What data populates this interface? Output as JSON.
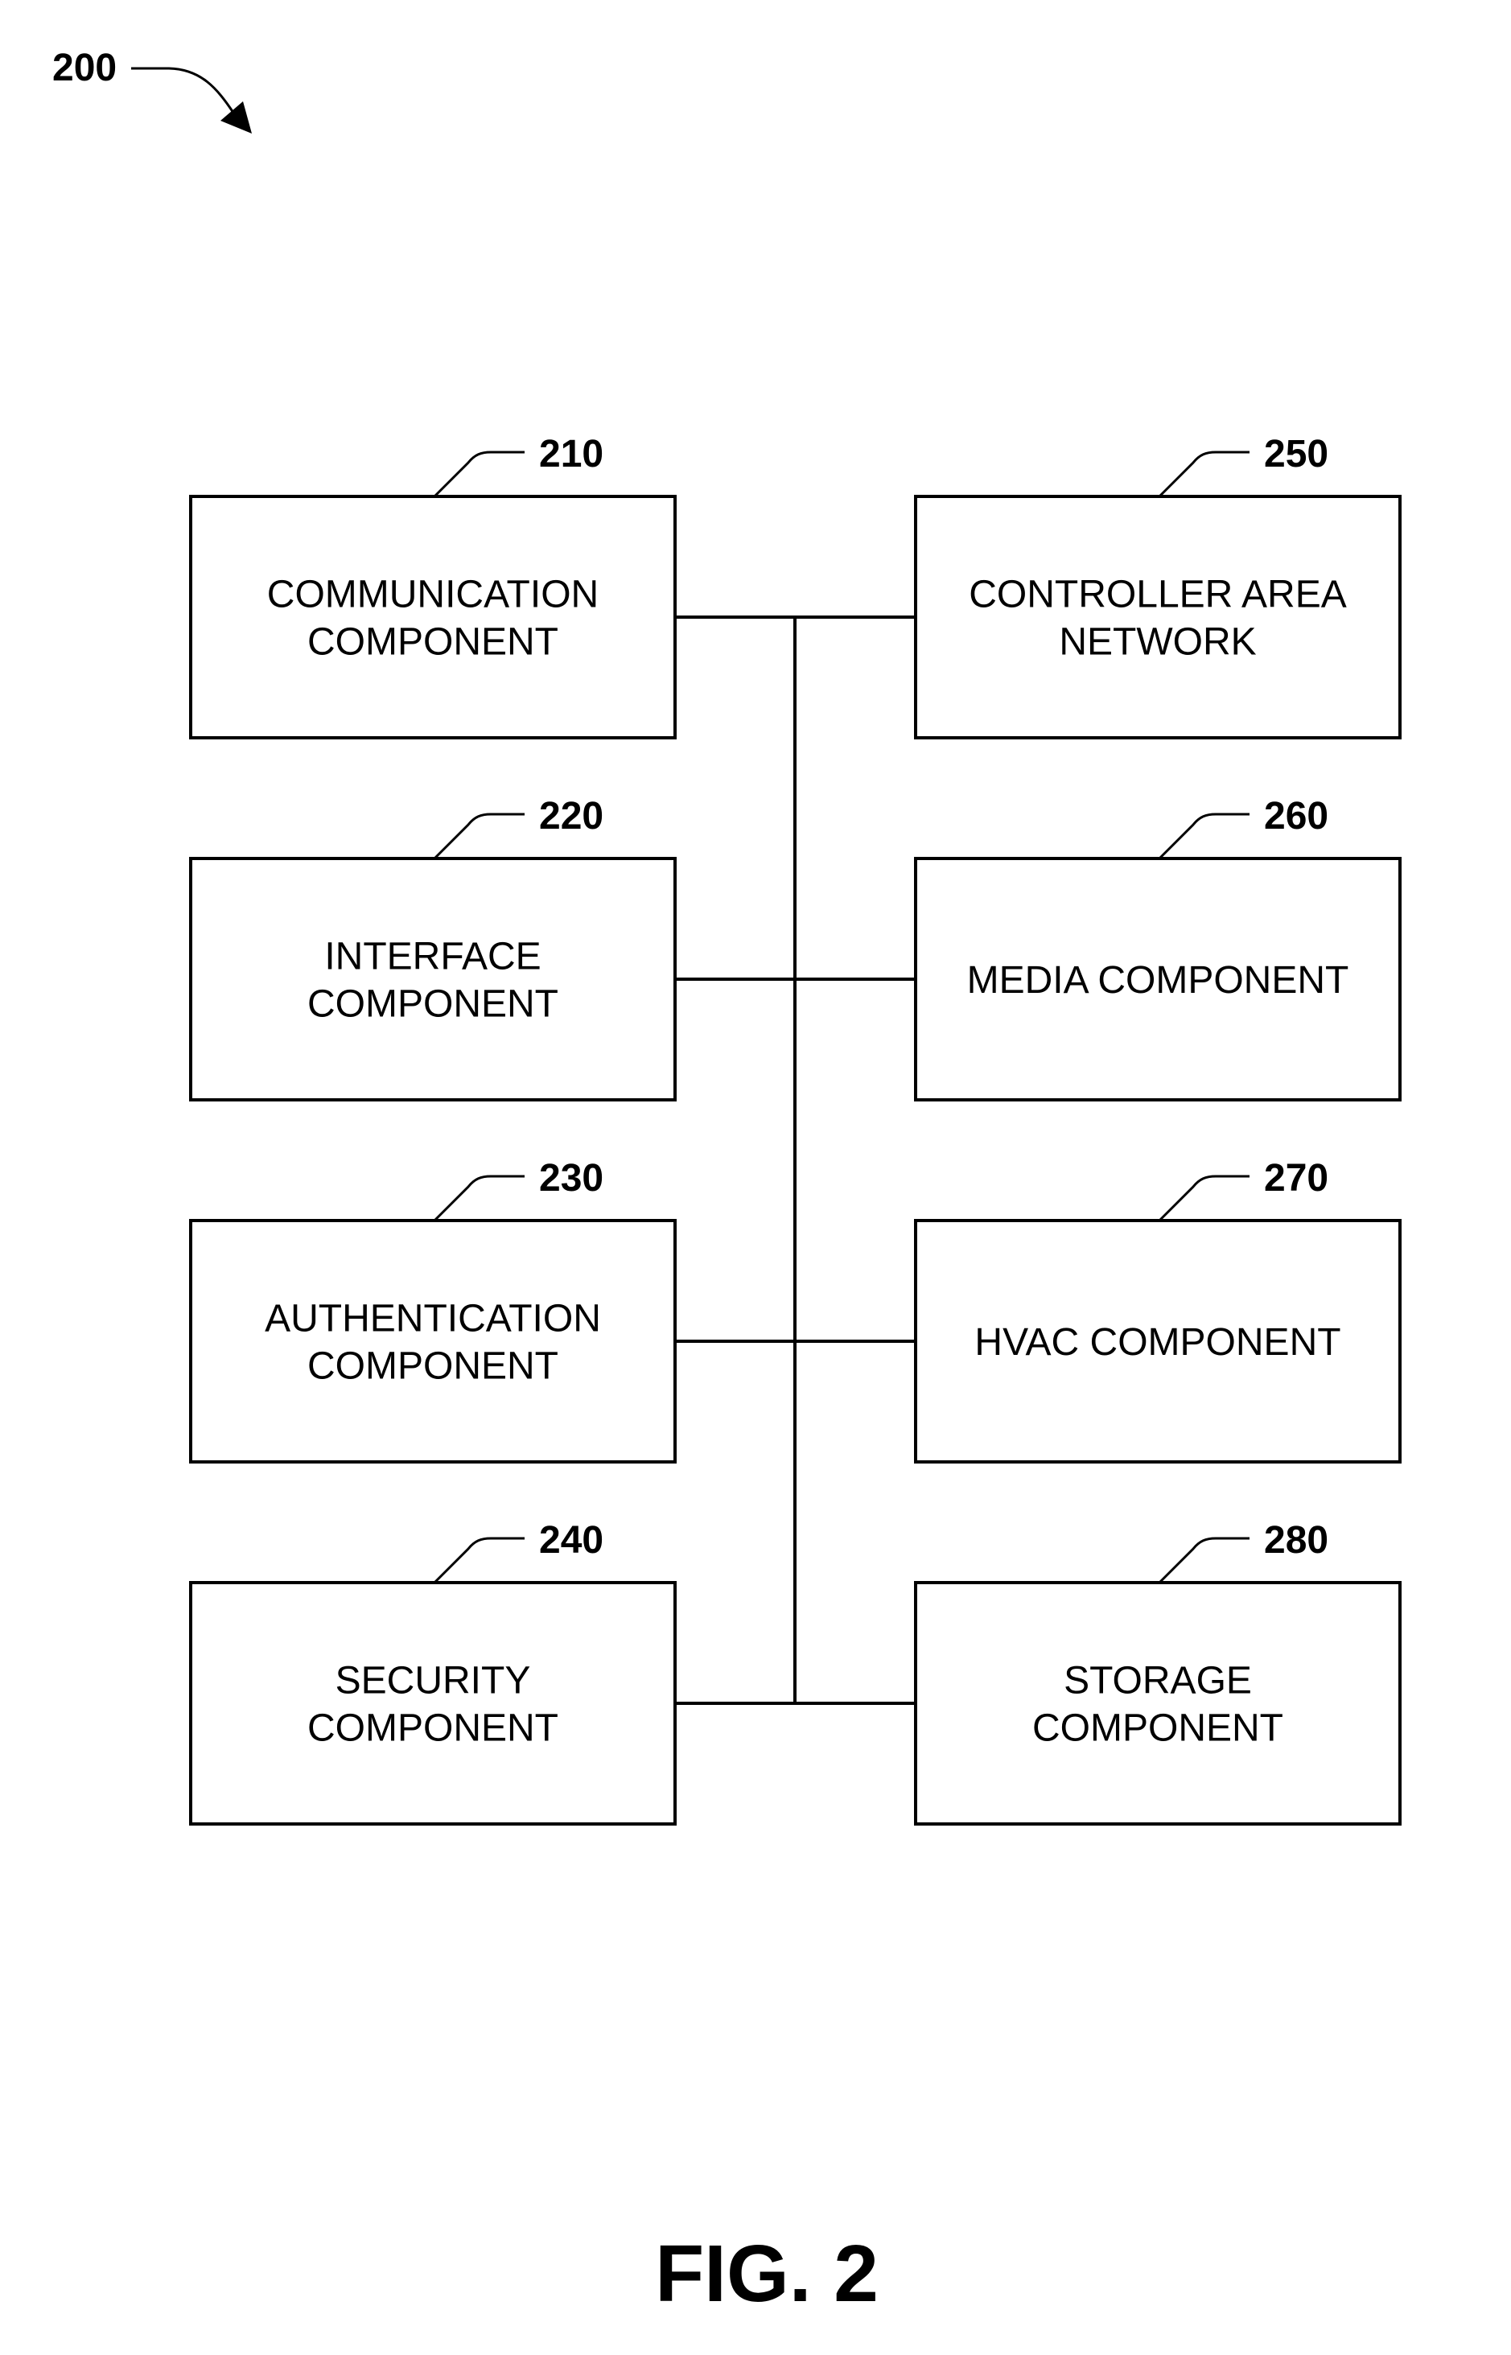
{
  "figure": {
    "reference_label": "200",
    "caption": "FIG. 2"
  },
  "components": [
    {
      "ref": "210",
      "lines": [
        "COMMUNICATION",
        "COMPONENT"
      ],
      "column": "left",
      "row": 0
    },
    {
      "ref": "220",
      "lines": [
        "INTERFACE",
        "COMPONENT"
      ],
      "column": "left",
      "row": 1
    },
    {
      "ref": "230",
      "lines": [
        "AUTHENTICATION",
        "COMPONENT"
      ],
      "column": "left",
      "row": 2
    },
    {
      "ref": "240",
      "lines": [
        "SECURITY",
        "COMPONENT"
      ],
      "column": "left",
      "row": 3
    },
    {
      "ref": "250",
      "lines": [
        "CONTROLLER AREA",
        "NETWORK"
      ],
      "column": "right",
      "row": 0
    },
    {
      "ref": "260",
      "lines": [
        "MEDIA COMPONENT"
      ],
      "column": "right",
      "row": 1
    },
    {
      "ref": "270",
      "lines": [
        "HVAC COMPONENT"
      ],
      "column": "right",
      "row": 2
    },
    {
      "ref": "280",
      "lines": [
        "STORAGE",
        "COMPONENT"
      ],
      "column": "right",
      "row": 3
    }
  ],
  "connections": {
    "type": "shared-bus",
    "connected_refs": [
      "210",
      "220",
      "230",
      "240",
      "250",
      "260",
      "270",
      "280"
    ]
  }
}
